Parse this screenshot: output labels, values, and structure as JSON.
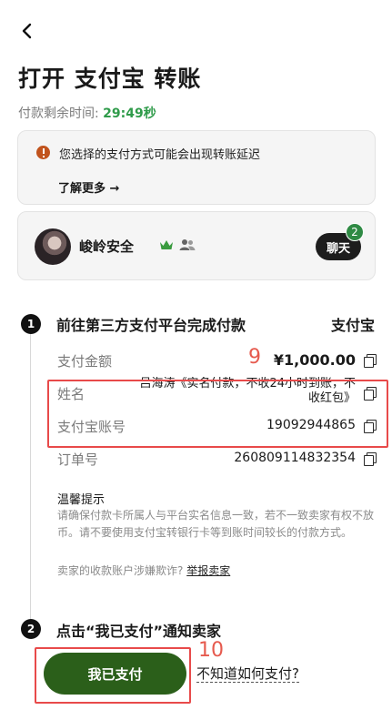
{
  "header": {
    "title": "打开 支付宝 转账",
    "timer_label": "付款剩余时间:",
    "timer_value": "29:49秒"
  },
  "notice": {
    "message": "您选择的支付方式可能会出现转账延迟",
    "learn_more": "了解更多 →"
  },
  "seller": {
    "name": "峻岭安全",
    "chat_label": "聊天",
    "unread_count": "2"
  },
  "step1": {
    "number": "1",
    "title": "前往第三方支付平台完成付款",
    "method": "支付宝",
    "amount_label": "支付金额",
    "amount_value": "¥1,000.00",
    "name_label": "姓名",
    "name_value": "吕海涛《实名付款，不收24小时到账，不收红包》",
    "account_label": "支付宝账号",
    "account_value": "19092944865",
    "order_label": "订单号",
    "order_value": "260809114832354"
  },
  "tips": {
    "title": "温馨提示",
    "body": "请确保付款卡所属人与平台实名信息一致，若不一致卖家有权不放币。请不要使用支付宝转银行卡等到账时间较长的付款方式。",
    "fraud_question": "卖家的收款账户涉嫌欺诈?",
    "report_link": "举报卖家"
  },
  "step2": {
    "number": "2",
    "title": "点击“我已支付”通知卖家",
    "paid_button": "我已支付",
    "how_to_pay": "不知道如何支付?"
  },
  "annotations": {
    "label_9": "9",
    "label_10": "10"
  },
  "colors": {
    "timer_green": "#2f9b4a",
    "primary_button": "#2b5f1a",
    "annotation_red": "#e84a4a",
    "warn_orange": "#c1531d"
  }
}
